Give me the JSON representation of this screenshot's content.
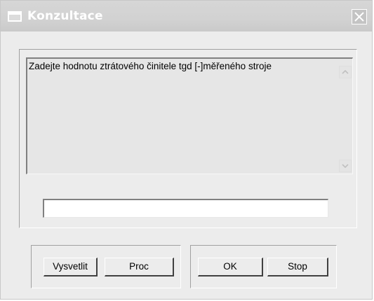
{
  "window": {
    "title": "Konzultace",
    "icons": {
      "app": "window-icon",
      "close": "close-icon"
    }
  },
  "message": {
    "text": "Zadejte hodnotu ztrátového činitele tgd [-]měřeného stroje",
    "icons": {
      "up": "scroll-up-arrow-icon",
      "down": "scroll-down-arrow-icon"
    }
  },
  "answer": {
    "value": ""
  },
  "buttons": {
    "explain": "Vysvetlit",
    "why": "Proc",
    "ok": "OK",
    "stop": "Stop"
  },
  "colors": {
    "titlebar": "#d2d2d2",
    "dialog": "#ececec",
    "memo": "#e6e6e6",
    "input": "#ffffff"
  }
}
